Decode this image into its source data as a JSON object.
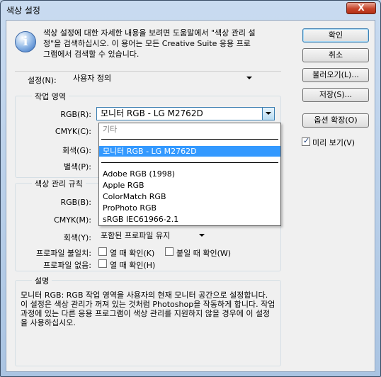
{
  "window": {
    "title": "색상 설정",
    "close_label": "X"
  },
  "info": {
    "icon": "info-icon",
    "text": "색상 설정에 대한 자세한 내용을 보려면 도움말에서 \"색상 관리 설정\"을 검색하십시오. 이 용어는 모든 Creative Suite 응용 프로그램에서 검색할 수 있습니다."
  },
  "buttons": {
    "ok": "확인",
    "cancel": "취소",
    "load": "불러오기(L)...",
    "save": "저장(S)...",
    "more_options": "옵션 확장(O)"
  },
  "preview": {
    "label": "미리 보기(V)",
    "checked": true
  },
  "settings": {
    "label": "설정(N):",
    "value": "사용자 정의"
  },
  "working_spaces": {
    "title": "작업 영역",
    "rgb_label": "RGB(R):",
    "rgb_value": "모니터 RGB - LG M2762D",
    "cmyk_label": "CMYK(C):",
    "gray_label": "회색(G):",
    "spot_label": "별색(P):"
  },
  "dropdown": {
    "items": [
      {
        "label": "기타",
        "style": "gray"
      },
      {
        "label": "모니터 RGB - LG M2762D",
        "style": "sel"
      },
      {
        "label": "Adobe RGB (1998)",
        "style": ""
      },
      {
        "label": "Apple RGB",
        "style": ""
      },
      {
        "label": "ColorMatch RGB",
        "style": ""
      },
      {
        "label": "ProPhoto RGB",
        "style": ""
      },
      {
        "label": "sRGB IEC61966-2.1",
        "style": ""
      }
    ]
  },
  "policies": {
    "title": "색상 관리 규칙",
    "rgb_label": "RGB(B):",
    "cmyk_label": "CMYK(M):",
    "gray_label": "회색(Y):",
    "gray_value": "포함된 프로파일 유지",
    "mismatch_label": "프로파일 불일치:",
    "mismatch_open": "열 때 확인(K)",
    "mismatch_paste": "붙일 때 확인(W)",
    "missing_label": "프로파일 없음:",
    "missing_open": "열 때 확인(H)"
  },
  "description": {
    "title": "설명",
    "text": "모니터 RGB: RGB 작업 영역을 사용자의 현재 모니터 공간으로 설정합니다. 이 설정은 색상 관리가 꺼져 있는 것처럼 Photoshop을 작동하게 합니다. 작업 과정에 있는 다른 응용 프로그램이 색상 관리를 지원하지 않을 경우에 이 설정을 사용하십시오."
  }
}
